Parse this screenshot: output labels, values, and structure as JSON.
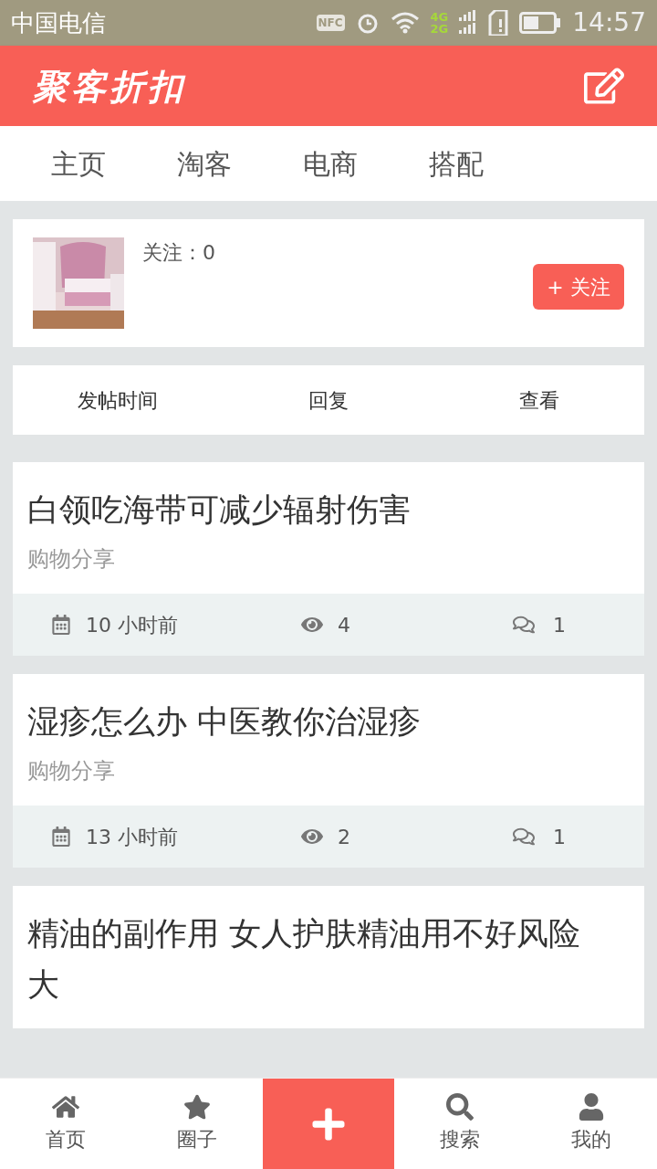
{
  "status_bar": {
    "carrier": "中国电信",
    "nfc": "NFC",
    "network": [
      "4G",
      "2G"
    ],
    "time": "14:57"
  },
  "header": {
    "logo": "聚客折扣"
  },
  "tabs": [
    {
      "label": "主页"
    },
    {
      "label": "淘客"
    },
    {
      "label": "电商"
    },
    {
      "label": "搭配"
    }
  ],
  "profile": {
    "follow_count": "关注：0",
    "follow_button": "+ 关注"
  },
  "sort_bar": [
    "发帖时间",
    "回复",
    "查看"
  ],
  "posts": [
    {
      "title": "白领吃海带可减少辐射伤害",
      "category": "购物分享",
      "time": "10 小时前",
      "views": "4",
      "replies": "1"
    },
    {
      "title": "湿疹怎么办 中医教你治湿疹",
      "category": "购物分享",
      "time": "13 小时前",
      "views": "2",
      "replies": "1"
    },
    {
      "title": "精油的副作用 女人护肤精油用不好风险大"
    }
  ],
  "bottom_nav": [
    {
      "kind": "home",
      "label": "首页"
    },
    {
      "kind": "circle",
      "label": "圈子"
    },
    {
      "kind": "add"
    },
    {
      "kind": "search",
      "label": "搜索"
    },
    {
      "kind": "profile",
      "label": "我的"
    }
  ]
}
